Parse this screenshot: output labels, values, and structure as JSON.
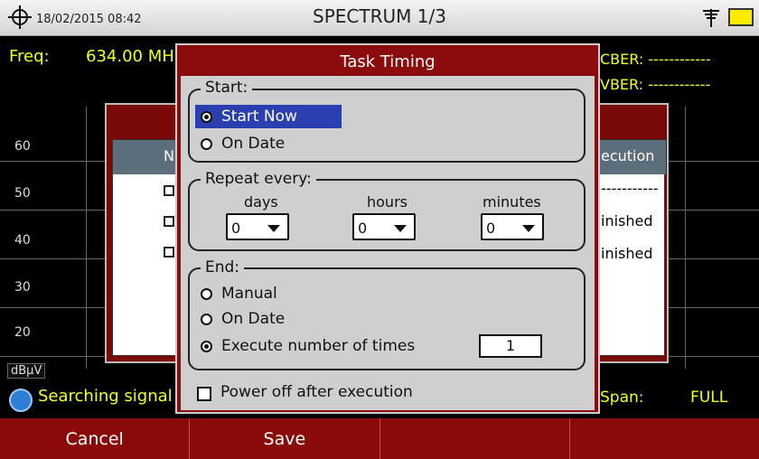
{
  "topbar": {
    "datetime": "18/02/2015 08:42",
    "title": "SPECTRUM 1/3",
    "icons": [
      "crosshair-icon",
      "antenna-icon",
      "battery-icon"
    ]
  },
  "measure": {
    "freq_label": "Freq:",
    "freq_value": "634.00 MH",
    "cber": "CBER: ------------",
    "vber": "VBER: ------------"
  },
  "plot": {
    "y_ticks": [
      "60",
      "50",
      "40",
      "30",
      "20"
    ],
    "unit": "dBμV"
  },
  "background_table": {
    "header_fragment": "N",
    "header_execution": "ecution",
    "rows": [
      "-----------",
      "inished",
      "inished"
    ]
  },
  "status": {
    "searching": "Searching signal",
    "span_label": "Span:",
    "span_value": "FULL"
  },
  "softkeys": [
    "Cancel",
    "Save",
    "",
    ""
  ],
  "dialog": {
    "title": "Task Timing",
    "start": {
      "label": "Start:",
      "options": [
        "Start Now",
        "On Date"
      ],
      "selected": "Start Now"
    },
    "repeat": {
      "label": "Repeat every:",
      "days_label": "days",
      "hours_label": "hours",
      "minutes_label": "minutes",
      "days_value": "0",
      "hours_value": "0",
      "minutes_value": "0"
    },
    "end": {
      "label": "End:",
      "options": [
        "Manual",
        "On Date",
        "Execute number of times"
      ],
      "selected": "Execute number of times",
      "times_value": "1"
    },
    "power_off": {
      "label": "Power off after execution",
      "checked": false
    }
  },
  "colors": {
    "accent_yellow": "#f0ff20",
    "dialog_red": "#8a0c0c",
    "selection_blue": "#2a3fb0"
  }
}
